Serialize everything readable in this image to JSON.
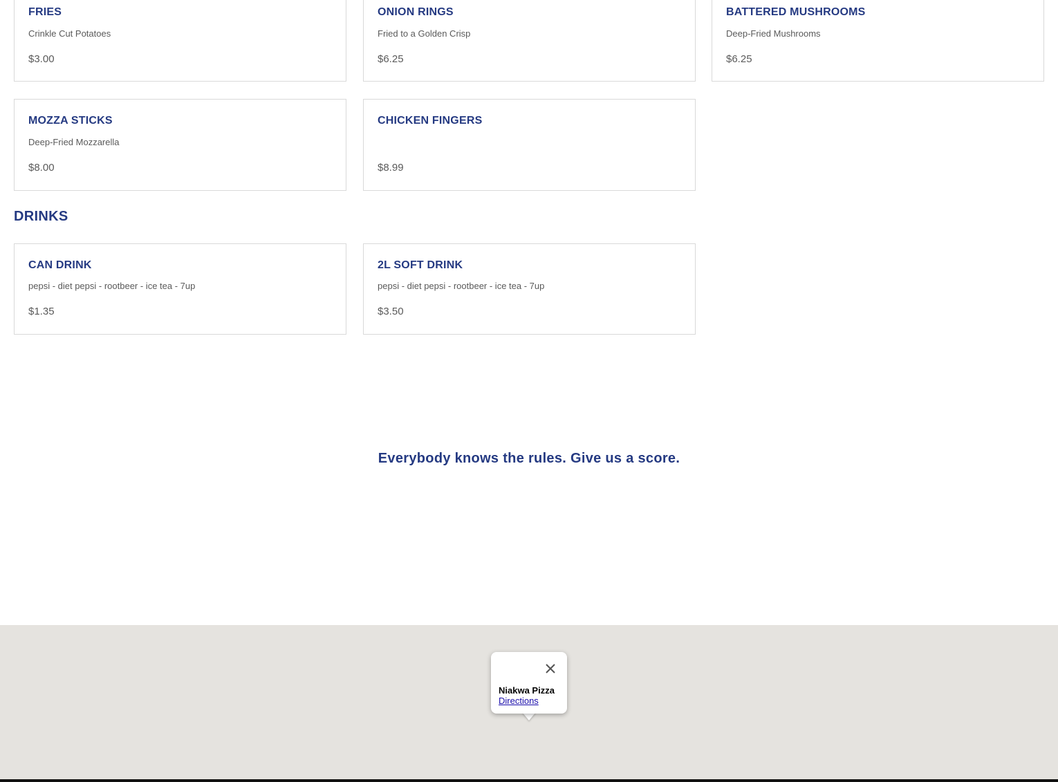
{
  "appetizers": {
    "items": [
      {
        "name": "FRIES",
        "description": "Crinkle Cut Potatoes",
        "price": "$3.00"
      },
      {
        "name": "ONION RINGS",
        "description": "Fried to a Golden Crisp",
        "price": "$6.25"
      },
      {
        "name": "BATTERED MUSHROOMS",
        "description": "Deep-Fried Mushrooms",
        "price": "$6.25"
      },
      {
        "name": "MOZZA STICKS",
        "description": "Deep-Fried Mozzarella",
        "price": "$8.00"
      },
      {
        "name": "CHICKEN FINGERS",
        "description": "",
        "price": "$8.99"
      }
    ]
  },
  "drinks": {
    "title": "DRINKS",
    "items": [
      {
        "name": "CAN DRINK",
        "description": "pepsi - diet pepsi - rootbeer - ice tea - 7up",
        "price": "$1.35"
      },
      {
        "name": "2L SOFT DRINK",
        "description": "pepsi - diet pepsi - rootbeer - ice tea - 7up",
        "price": "$3.50"
      }
    ]
  },
  "tagline": "Everybody knows the rules. Give us a score.",
  "map": {
    "info_window": {
      "place_name": "Niakwa Pizza",
      "directions_label": "Directions",
      "close_icon": "close-icon"
    }
  },
  "colors": {
    "heading": "#253a82",
    "text": "#5a5a5a",
    "card_border": "#d9d9d9",
    "map_background": "#e5e3df",
    "link": "#1a0dab"
  }
}
